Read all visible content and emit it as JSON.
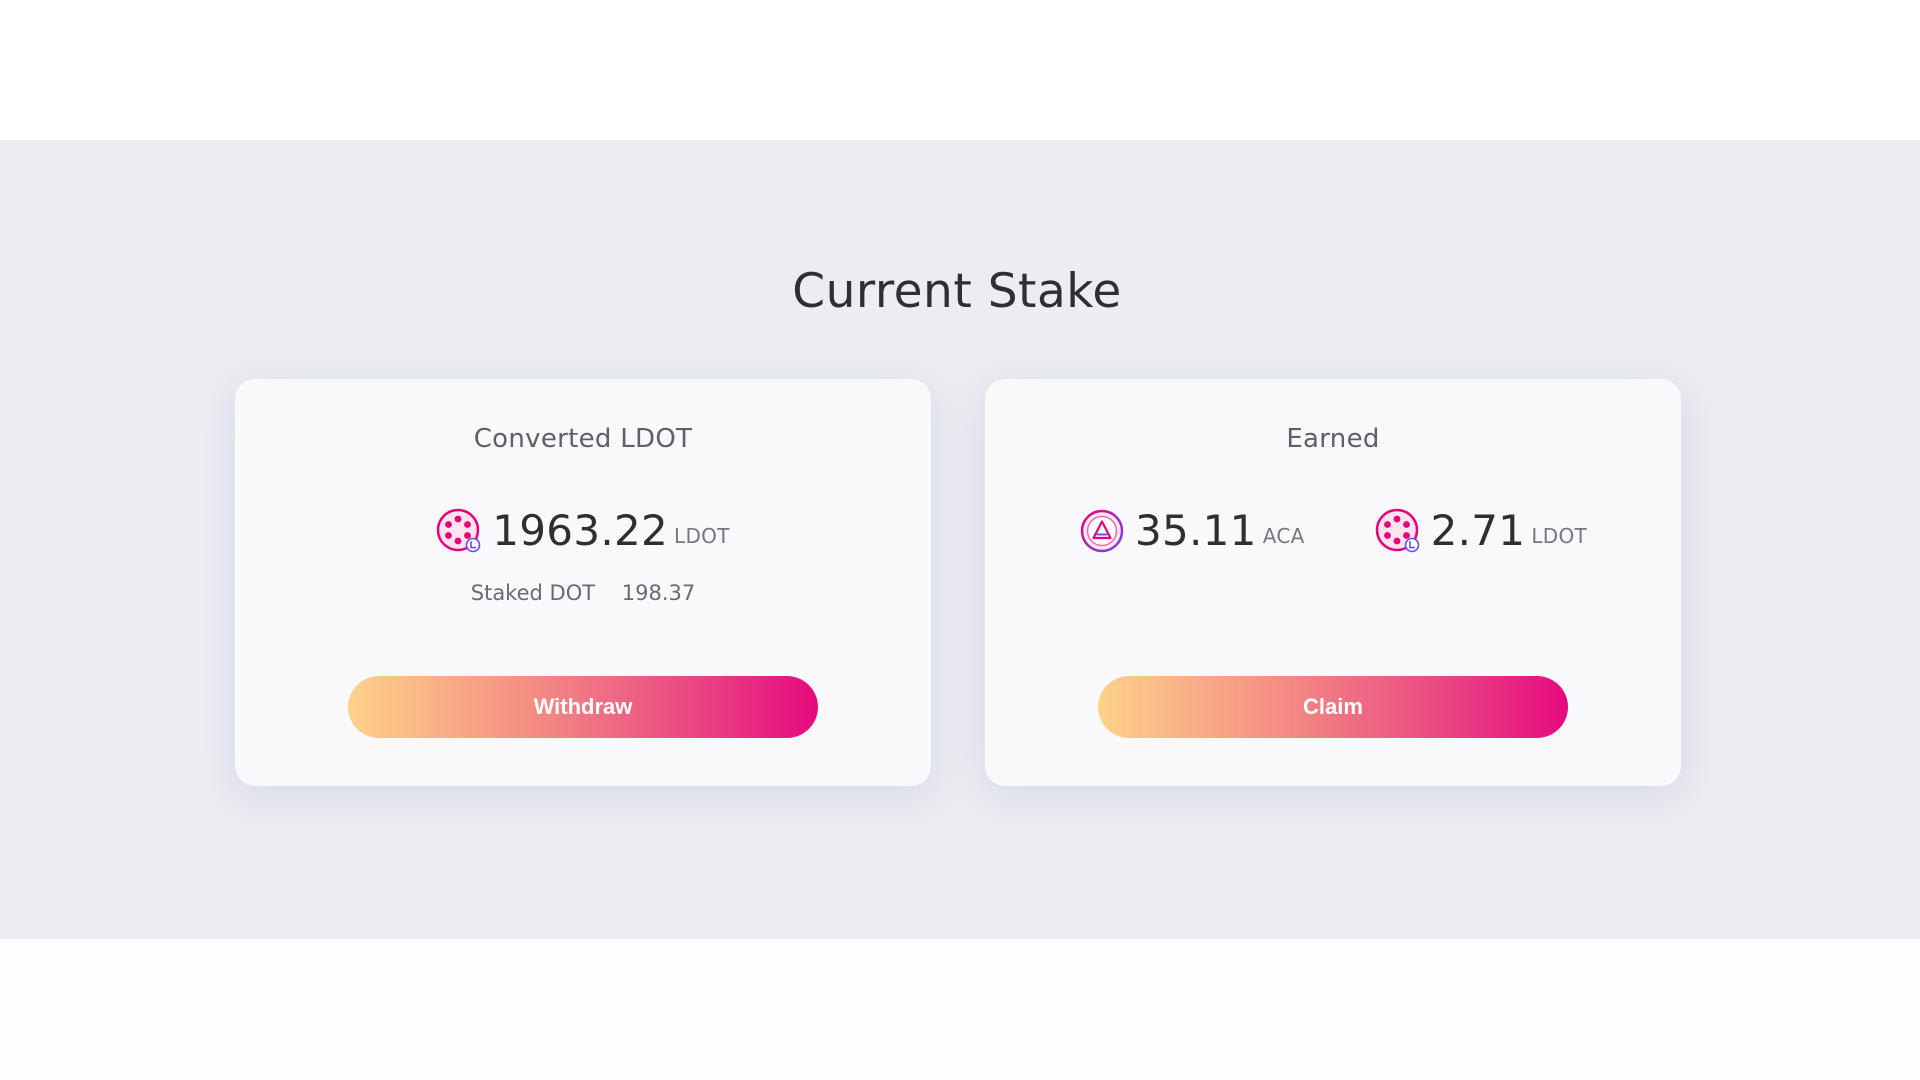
{
  "page": {
    "title": "Current Stake"
  },
  "converted_card": {
    "label": "Converted LDOT",
    "token_icon": "ldot-token-icon",
    "amount": "1963.22",
    "unit": "LDOT",
    "staked_label": "Staked DOT",
    "staked_value": "198.37",
    "button_label": "Withdraw"
  },
  "earned_card": {
    "label": "Earned",
    "rewards": [
      {
        "icon": "aca-token-icon",
        "amount": "35.11",
        "unit": "ACA"
      },
      {
        "icon": "ldot-token-icon",
        "amount": "2.71",
        "unit": "LDOT"
      }
    ],
    "button_label": "Claim"
  },
  "colors": {
    "section_background": "#ecedf2",
    "card_background": "#f9f9fb",
    "button_gradient_start": "#fdd28a",
    "button_gradient_end": "#e60a7f",
    "ldot_pink": "#e6007a",
    "aca_purple": "#6c4bea"
  }
}
